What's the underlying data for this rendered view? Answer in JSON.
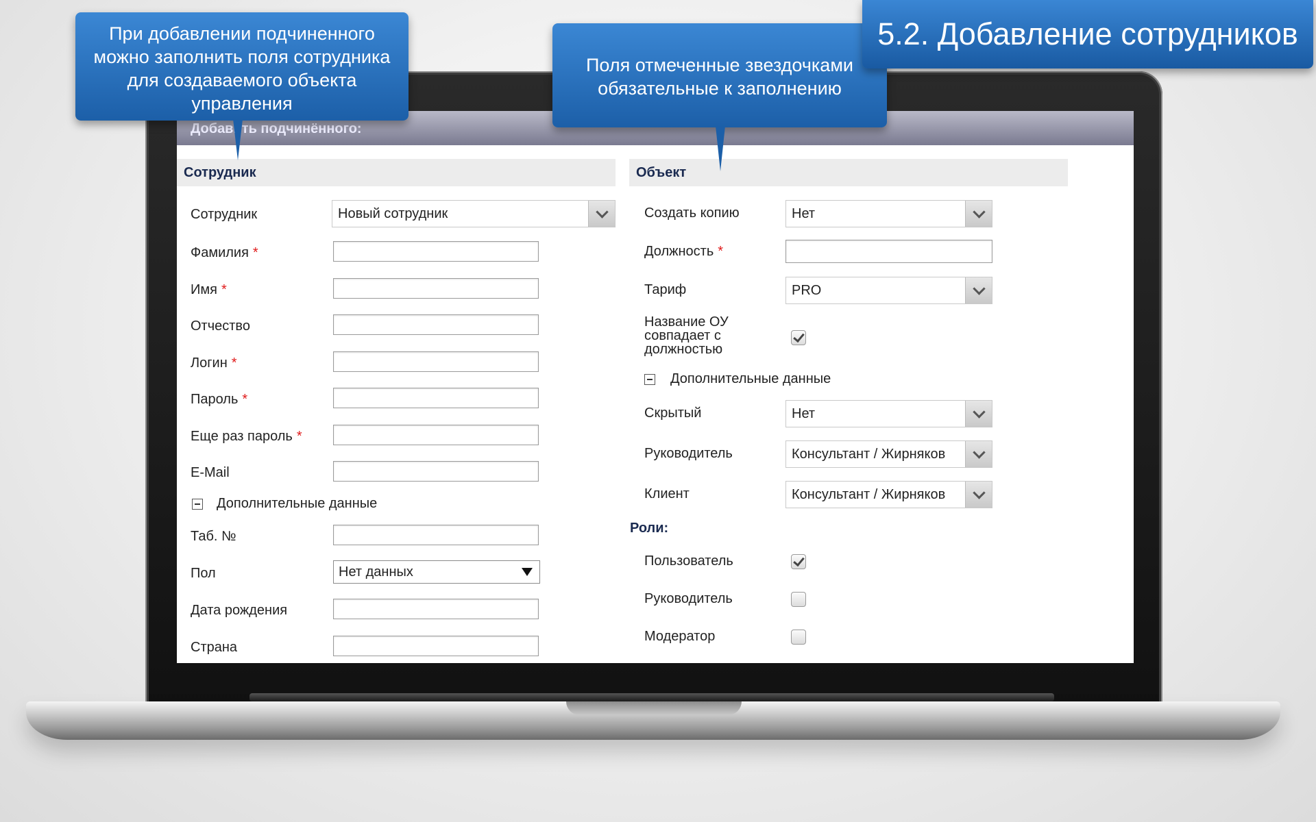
{
  "slide_title": "5.2. Добавление сотрудников",
  "callouts": {
    "left": "При добавлении подчиненного можно заполнить поля сотрудника для создаваемого объекта управления",
    "center": "Поля отмеченные звездочками обязательные к заполнению"
  },
  "app": {
    "header_title": "Добавить подчинённого:",
    "employee_section": {
      "title": "Сотрудник",
      "employee_label": "Сотрудник",
      "employee_value": "Новый сотрудник",
      "fields": [
        {
          "label": "Фамилия",
          "required": "*",
          "value": ""
        },
        {
          "label": "Имя",
          "required": "*",
          "value": ""
        },
        {
          "label": "Отчество",
          "required": "",
          "value": ""
        },
        {
          "label": "Логин",
          "required": "*",
          "value": ""
        },
        {
          "label": "Пароль",
          "required": "*",
          "value": ""
        },
        {
          "label": "Еще раз пароль",
          "required": "*",
          "value": ""
        },
        {
          "label": "E-Mail",
          "required": "",
          "value": ""
        }
      ],
      "additional_title": "Дополнительные данные",
      "tab_number_label": "Таб. №",
      "gender_label": "Пол",
      "gender_value": "Нет данных",
      "birthdate_label": "Дата рождения",
      "country_label": "Страна"
    },
    "object_section": {
      "title": "Объект",
      "copy_label": "Создать копию",
      "copy_value": "Нет",
      "position_label": "Должность",
      "position_required": "*",
      "tariff_label": "Тариф",
      "tariff_value": "PRO",
      "ou_name_label_1": "Название ОУ",
      "ou_name_label_2": "совпадает с",
      "ou_name_label_3": "должностью",
      "ou_name_checked": true,
      "additional_title": "Дополнительные данные",
      "hidden_label": "Скрытый",
      "hidden_value": "Нет",
      "manager_label": "Руководитель",
      "manager_value": "Консультант / Жирняков",
      "client_label": "Клиент",
      "client_value": "Консультант / Жирняков",
      "roles_title": "Роли:",
      "roles": [
        {
          "label": "Пользователь",
          "checked": true
        },
        {
          "label": "Руководитель",
          "checked": false
        },
        {
          "label": "Модератор",
          "checked": false
        }
      ]
    }
  },
  "colors": {
    "callout_blue": "#2a73c0",
    "required_red": "#e01b1b",
    "section_heading": "#1a2a50"
  }
}
